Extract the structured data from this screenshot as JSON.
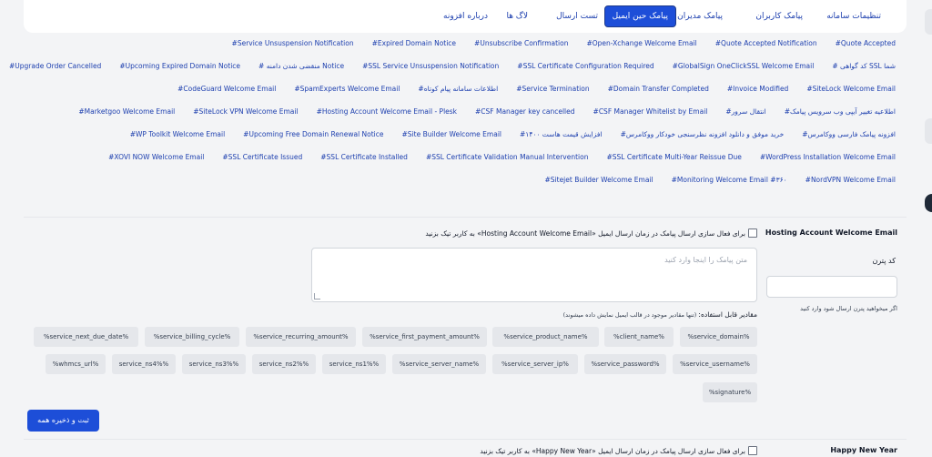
{
  "tabs": [
    {
      "label": "تنظیمات سامانه",
      "active": false
    },
    {
      "label": "پیامک کاربران",
      "active": false
    },
    {
      "label": "پیامک مدیران",
      "active": false
    },
    {
      "label": "پیامک حین ایمیل",
      "active": true
    },
    {
      "label": "تست ارسال",
      "active": false
    },
    {
      "label": "لاگ ها",
      "active": false
    },
    {
      "label": "درباره افزونه",
      "active": false
    }
  ],
  "links": [
    [
      "#Quote Accepted",
      "#Quote Accepted Notification",
      "#Open-Xchange Welcome Email",
      "#Unsubscribe Confirmation",
      "#Expired Domain Notice",
      "#Service Unsuspension Notification"
    ],
    [
      "# کد گواهی SSL شما",
      "#GlobalSign OneClickSSL Welcome Email",
      "#SSL Certificate Configuration Required",
      "#SSL Service Unsuspension Notification",
      "# منقضی شدن دامنه Notice",
      "#Upcoming Expired Domain Notice",
      "#Upgrade Order Cancelled"
    ],
    [
      "#SiteLock Welcome Email",
      "#Invoice Modified",
      "#Domain Transfer Completed",
      "#Service Termination",
      "#اطلاعات سامانه پیام کوتاه",
      "#SpamExperts Welcome Email",
      "#CodeGuard Welcome Email"
    ],
    [
      "#اطلاعیه تغییر آیپی وب سرویس پیامک",
      "#انتقال سرور",
      "#CSF Manager Whitelist by Email",
      "#CSF Manager key cancelled",
      "#Hosting Account Welcome Email - Plesk",
      "#SiteLock VPN Welcome Email",
      "#Marketgoo Welcome Email"
    ],
    [
      "#افزونه پیامک فارسی ووکامرس",
      "#خرید موفق و دانلود افزونه نظرسنجی خودکار ووکامرس",
      "#افزایش قیمت هاست ۱۴۰۰",
      "#Site Builder Welcome Email",
      "#Upcoming Free Domain Renewal Notice",
      "#WP Toolkit Welcome Email"
    ],
    [
      "#WordPress Installation Welcome Email",
      "#SSL Certificate Multi-Year Reissue Due",
      "#SSL Certificate Validation Manual Intervention",
      "#SSL Certificate Installed",
      "#SSL Certificate Issued",
      "#XOVI NOW Welcome Email"
    ],
    [
      "#NordVPN Welcome Email",
      "#Monitoring Welcome Email #۳۶۰",
      "#Sitejet Builder Welcome Email"
    ]
  ],
  "section1": {
    "title": "Hosting Account Welcome Email",
    "checkbox_label": "برای فعال سازی ارسال پیامک در زمان ارسال ایمیل «Hosting Account Welcome Email» به کاربر تیک بزنید",
    "pattern_label": "کد پترن",
    "pattern_help": "اگر میخواهید پترن ارسال شود وارد کنید",
    "textarea_placeholder": "متن پیامک را اینجا وارد کنید",
    "vars_help_bold": "مقادیر قابل استفاده:",
    "vars_help_small": " (تنها مقادیر موجود در قالب ایمیل نمایش داده میشوند)",
    "chips_row1": [
      "%service_domain%",
      "%client_name%",
      "%service_product_name%",
      "%service_first_payment_amount%",
      "%service_recurring_amount%",
      "%service_billing_cycle%",
      "%service_next_due_date%"
    ],
    "chips_row2": [
      "%service_username%",
      "%service_password%",
      "%service_server_ip%",
      "%service_server_name%",
      "service_ns1%%",
      "service_ns2%%",
      "service_ns3%%",
      "service_ns4%%",
      "%whmcs_url%"
    ],
    "chips_row3": [
      "%signature%"
    ]
  },
  "save_button": "ثبت و ذخیره همه",
  "section2": {
    "title": "Happy New Year",
    "checkbox_label": "برای فعال سازی ارسال پیامک در زمان ارسال ایمیل «Happy New Year» به کاربر تیک بزنید"
  }
}
